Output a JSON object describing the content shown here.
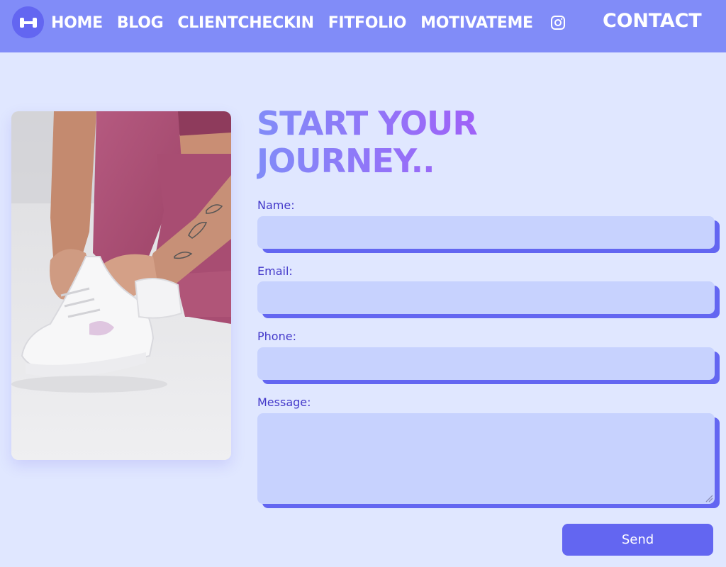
{
  "nav": {
    "logo_icon": "dumbbell-icon",
    "links": [
      {
        "label": "HOME"
      },
      {
        "label": "BLOG"
      },
      {
        "label": "CLIENTCHECKIN"
      },
      {
        "label": "FITFOLIO"
      },
      {
        "label": "MOTIVATEME"
      }
    ],
    "instagram_icon": "instagram-icon",
    "contact_label": "CONTACT"
  },
  "hero": {
    "heading": "START YOUR JOURNEY..",
    "photo_alt": "woman-tying-white-sneaker"
  },
  "form": {
    "name_label": "Name:",
    "name_value": "",
    "email_label": "Email:",
    "email_value": "",
    "phone_label": "Phone:",
    "phone_value": "",
    "message_label": "Message:",
    "message_value": "",
    "send_label": "Send"
  },
  "colors": {
    "nav_bg": "#818cf8",
    "page_bg": "#e0e7ff",
    "field_bg": "#c7d2fe",
    "accent": "#6366f1",
    "heading_start": "#818cf8",
    "heading_end": "#a855f7"
  }
}
